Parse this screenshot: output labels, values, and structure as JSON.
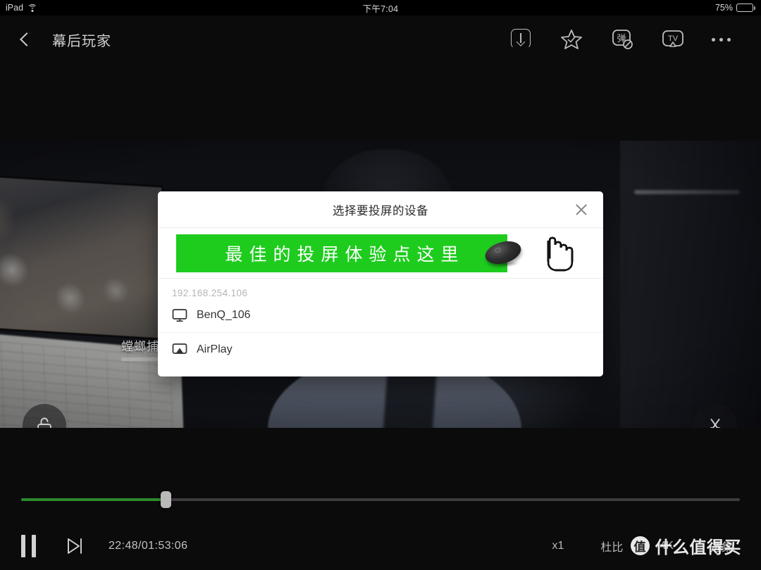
{
  "statusbar": {
    "device": "iPad",
    "time": "下午7:04",
    "battery_percent": "75%",
    "wifi_icon": "wifi-icon",
    "battery_icon": "battery-icon"
  },
  "topnav": {
    "back_icon": "back-chevron-icon",
    "title": "幕后玩家",
    "actions": [
      {
        "name": "download-icon",
        "label": "下载"
      },
      {
        "name": "favorite-star-icon",
        "label": "收藏"
      },
      {
        "name": "danmaku-off-icon",
        "label": "弹"
      },
      {
        "name": "cast-tv-icon",
        "label": "TV"
      },
      {
        "name": "more-options-icon",
        "label": "..."
      }
    ]
  },
  "video": {
    "subtitle": "螳螂捕",
    "lock_icon": "unlock-icon",
    "clip_icon": "scissors-icon"
  },
  "dialog": {
    "title": "选择要投屏的设备",
    "close_icon": "close-icon",
    "promo": {
      "text": "最佳的投屏体验点这里",
      "banner_color": "#1ecc1e",
      "device_icon": "cast-puck-icon",
      "cursor_icon": "pointing-hand-cursor-icon"
    },
    "ip_label": "192.168.254.106",
    "devices": [
      {
        "name": "BenQ_106",
        "icon": "monitor-icon"
      },
      {
        "name": "AirPlay",
        "icon": "airplay-icon"
      }
    ]
  },
  "player": {
    "pause_icon": "pause-icon",
    "next_icon": "next-episode-icon",
    "time": "22:48/01:53:06",
    "progress_percent": "20.1%",
    "progress_fill_color": "#2b8a2b",
    "options": [
      {
        "label": "x1",
        "name": "playback-speed-button"
      },
      {
        "label": "杜比",
        "name": "dolby-button"
      },
      {
        "label": "4K",
        "name": "quality-button"
      },
      {
        "label": "选集",
        "name": "episode-list-button"
      }
    ]
  },
  "watermark": {
    "logo": "值",
    "text": "什么值得买"
  }
}
